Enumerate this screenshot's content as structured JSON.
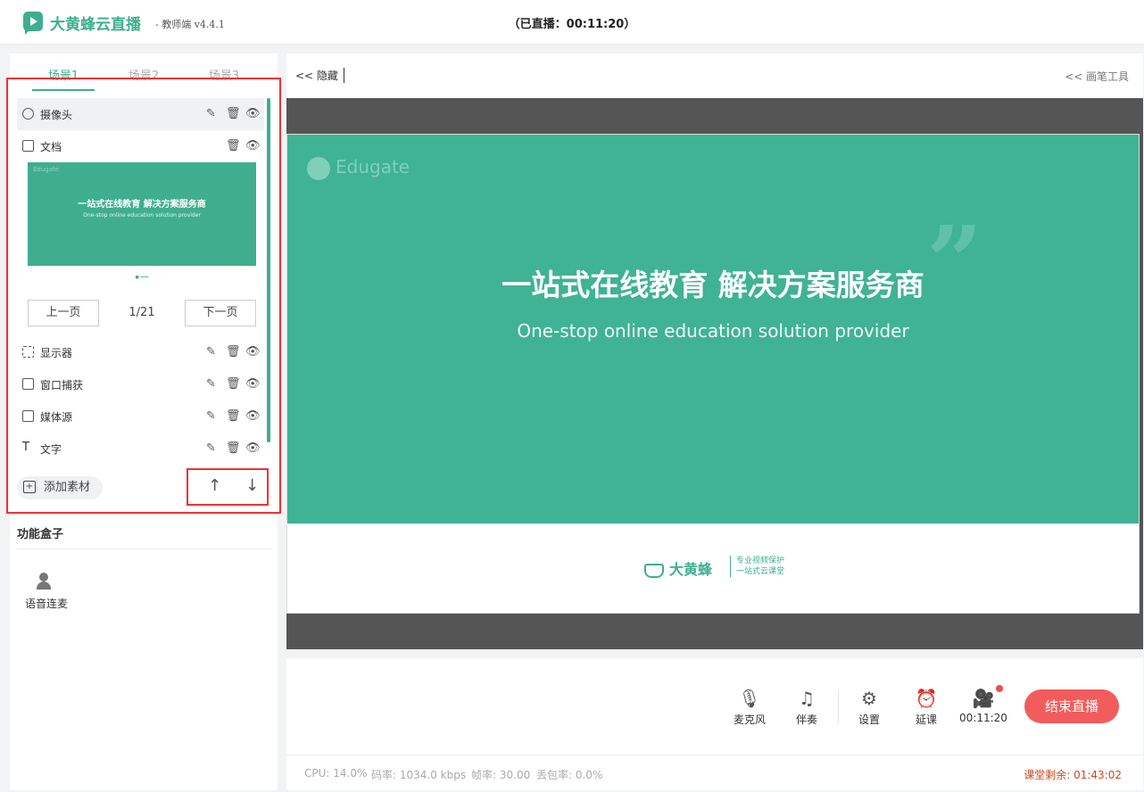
{
  "header": {
    "app_name": "大黄蜂云直播",
    "app_sub": "- 教师端 v4.4.1",
    "live_timer": "（已直播：00:11:20）"
  },
  "scenes": {
    "tabs": [
      {
        "label": "场景1",
        "active": true
      },
      {
        "label": "场景2",
        "active": false
      },
      {
        "label": "场景3",
        "active": false
      }
    ]
  },
  "sources": [
    {
      "label": "摄像头",
      "icon": "camera-icon",
      "active": true
    },
    {
      "label": "文档",
      "icon": "document-icon",
      "active": false
    },
    {
      "label": "显示器",
      "icon": "monitor-icon",
      "active": false
    },
    {
      "label": "窗口捕获",
      "icon": "window-icon",
      "active": false
    },
    {
      "label": "媒体源",
      "icon": "media-icon",
      "active": false
    },
    {
      "label": "文字",
      "icon": "text-icon",
      "active": false
    }
  ],
  "doc_preview": {
    "logo": "Edugate",
    "title": "一站式在线教育 解决方案服务商",
    "subtitle": "One-stop online education solution provider",
    "prev_label": "上一页",
    "page": "1/21",
    "next_label": "下一页"
  },
  "add_material_label": "添加素材",
  "function_box": {
    "title": "功能盒子",
    "items": [
      {
        "label": "语音连麦"
      }
    ]
  },
  "toolbar": {
    "hide_label": "<< 隐藏",
    "pen_label": "<< 画笔工具"
  },
  "slide": {
    "logo": "Edugate",
    "title": "一站式在线教育 解决方案服务商",
    "subtitle": "One-stop online education solution provider",
    "brand": "大黄蜂",
    "slogan_1": "专业视频保护",
    "slogan_2": "一站式云课堂"
  },
  "controls": [
    {
      "label": "麦克风",
      "icon": "microphone-icon"
    },
    {
      "label": "伴奏",
      "icon": "music-icon"
    },
    {
      "label": "设置",
      "icon": "gear-icon"
    },
    {
      "label": "延课",
      "icon": "alarm-icon"
    },
    {
      "label": "00:11:20",
      "icon": "record-icon"
    }
  ],
  "end_live_label": "结束直播",
  "status": {
    "cpu": "CPU: 14.0%",
    "bitrate": "码率: 1034.0 kbps",
    "fps": "帧率: 30.00",
    "loss": "丢包率: 0.0%",
    "remaining": "课堂剩余: 01:43:02"
  },
  "colors": {
    "accent": "#3fae8f",
    "danger": "#f25c5c",
    "highlight_box": "#e33333"
  }
}
